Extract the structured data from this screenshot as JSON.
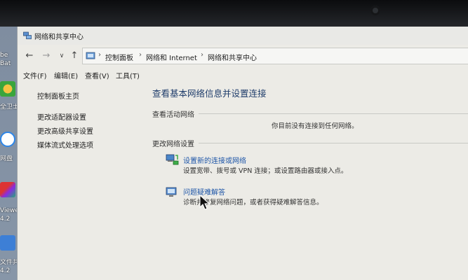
{
  "window": {
    "title": "网络和共享中心",
    "icon": "network-center-icon"
  },
  "nav": {
    "back_icon": "back-arrow-icon",
    "forward_icon": "forward-arrow-icon",
    "recent_icon": "chevron-down-icon",
    "up_icon": "up-arrow-icon"
  },
  "address": {
    "breadcrumbs": [
      "控制面板",
      "网络和 Internet",
      "网络和共享中心"
    ],
    "separator": "›"
  },
  "menu": [
    "文件(F)",
    "编辑(E)",
    "查看(V)",
    "工具(T)"
  ],
  "sidebar": {
    "items": [
      "控制面板主页",
      "更改适配器设置",
      "更改高级共享设置",
      "媒体流式处理选项"
    ]
  },
  "main": {
    "heading": "查看基本网络信息并设置连接",
    "active_networks_label": "查看活动网络",
    "no_connection_text": "你目前没有连接到任何网络。",
    "change_settings_label": "更改网络设置",
    "tasks": [
      {
        "title": "设置新的连接或网络",
        "description": "设置宽带、拨号或 VPN 连接；或设置路由器或接入点。",
        "icon": "new-connection-icon"
      },
      {
        "title": "问题疑难解答",
        "description": "诊断并修复网络问题，或者获得疑难解答信息。",
        "icon": "troubleshoot-icon"
      }
    ]
  },
  "desktop": {
    "labels": [
      "be",
      "Bat",
      "全卫士",
      "网盘",
      "Viewer",
      "4.2",
      "文件共",
      "4.2"
    ]
  },
  "colors": {
    "link": "#1e56a8",
    "heading": "#1f3d6b",
    "window_bg": "#ecebe6"
  }
}
